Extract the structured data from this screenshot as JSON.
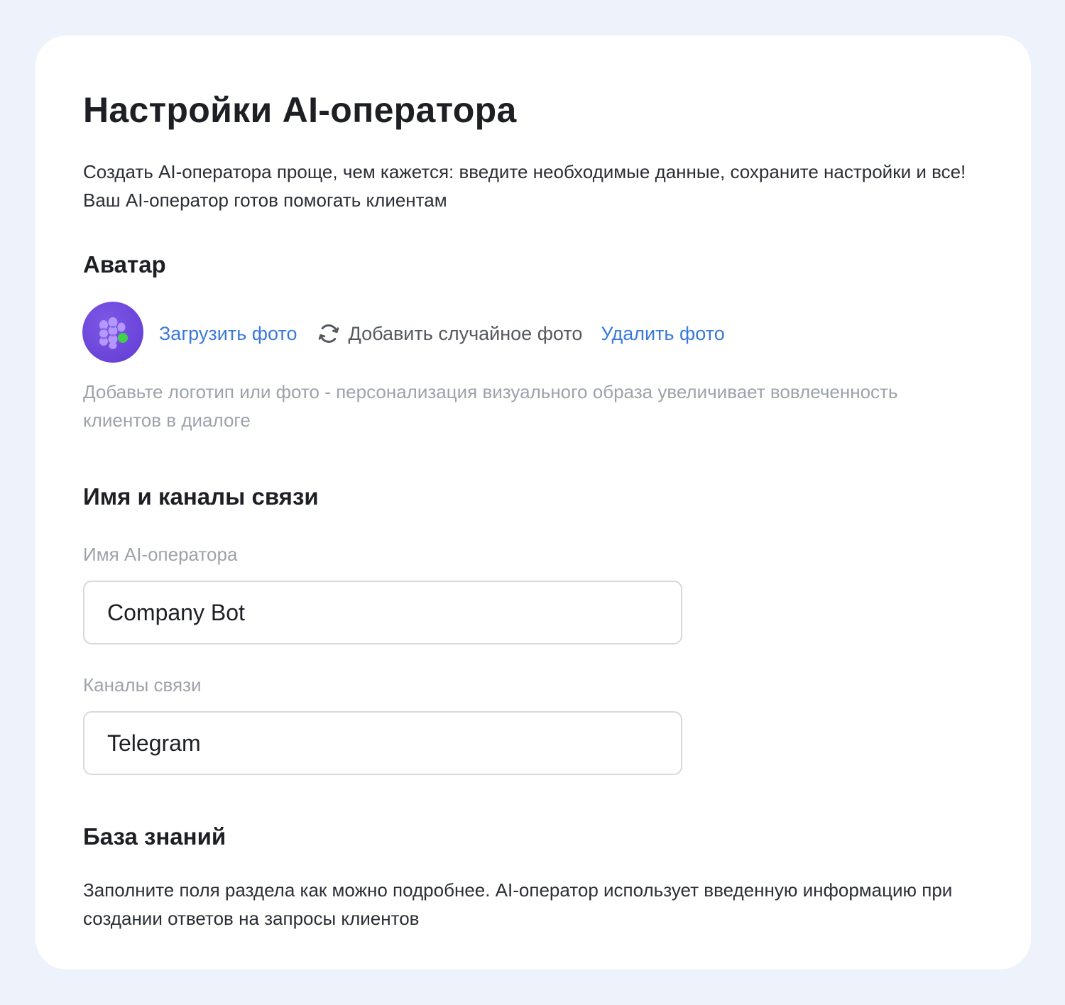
{
  "page": {
    "title": "Настройки AI-оператора",
    "intro": "Создать AI-оператора проще, чем кажется: введите необходимые данные, сохраните настройки и все! Ваш AI-оператор готов помогать клиентам"
  },
  "avatar_section": {
    "heading": "Аватар",
    "upload_label": "Загрузить фото",
    "random_label": "Добавить случайное фото",
    "delete_label": "Удалить фото",
    "hint": "Добавьте логотип или фото - персонализация визуального образа увеличивает вовлеченность клиентов в диалоге",
    "avatar_icon": "robot-logo-icon",
    "random_icon": "refresh-icon"
  },
  "name_section": {
    "heading": "Имя и каналы связи",
    "name_label": "Имя AI-оператора",
    "name_value": "Company Bot",
    "channels_label": "Каналы связи",
    "channels_value": "Telegram"
  },
  "knowledge_section": {
    "heading": "База знаний",
    "text": "Заполните поля раздела как можно подробнее. AI-оператор использует введенную информацию при создании ответов на запросы клиентов"
  },
  "colors": {
    "page_background": "#eef3fb",
    "card_background": "#ffffff",
    "link": "#3a79d9",
    "avatar": "#6a44d8",
    "status_dot": "#3fd14a",
    "muted_text": "#9ea2aa",
    "input_border": "#d7d9de"
  }
}
